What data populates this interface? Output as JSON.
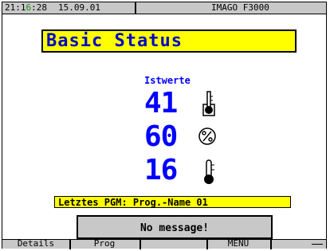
{
  "status_bar": {
    "time_h": "21:1",
    "time_mid": "6",
    "time_tail": ":28",
    "date": "15.09.01",
    "device": "IMAGO F3000"
  },
  "title": "Basic Status",
  "istwerte_label": "Istwerte",
  "readings": [
    {
      "value": "41",
      "icon": "thermometer-box-icon"
    },
    {
      "value": "60",
      "icon": "humidity-percent-icon"
    },
    {
      "value": "16",
      "icon": "thermometer-icon"
    }
  ],
  "program": "Letztes PGM: Prog.-Name 01",
  "message": "No message!",
  "function_keys": [
    "Details",
    "Prog",
    "",
    "MENU",
    ""
  ],
  "colors": {
    "title_bg": "#ffff00",
    "value": "#0000ff",
    "title_text": "#0000c8",
    "bars": "#c8c8c8"
  }
}
